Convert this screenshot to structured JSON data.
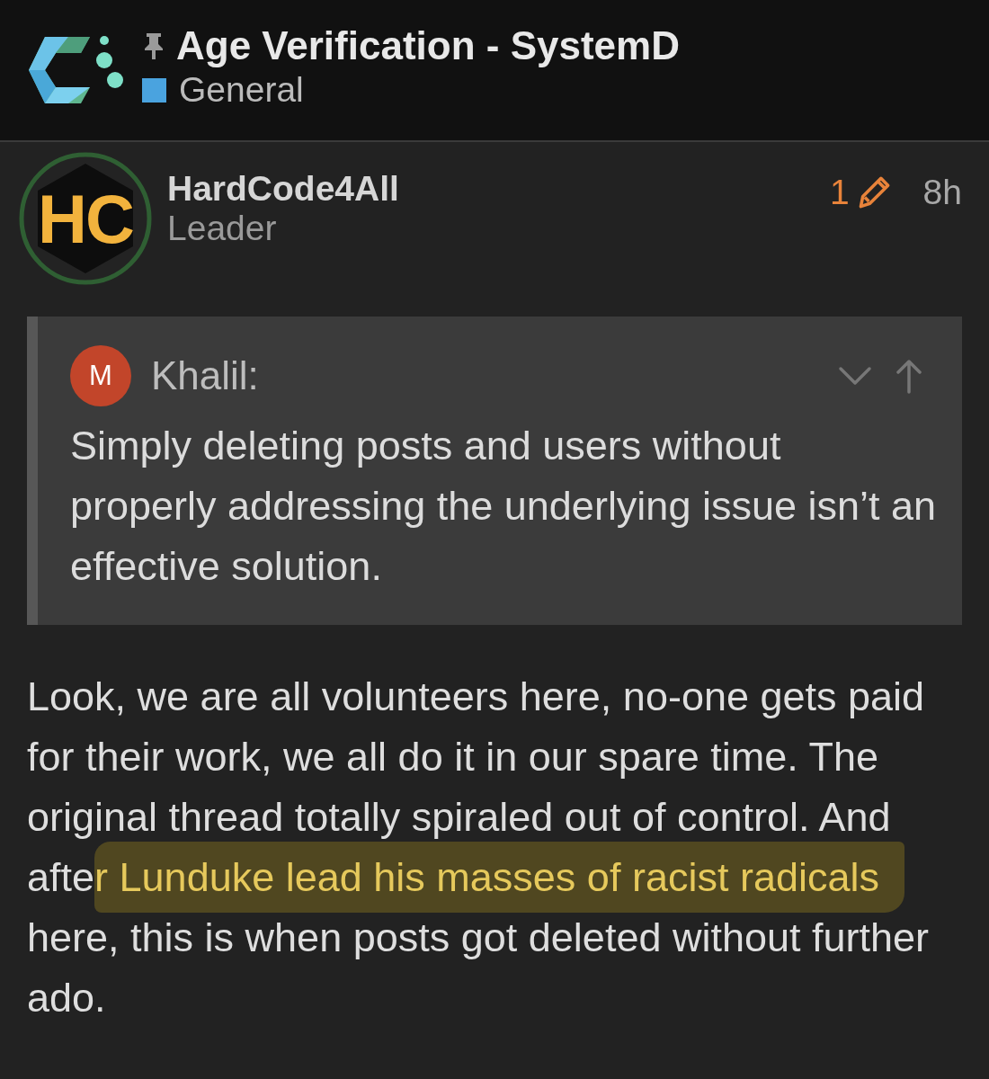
{
  "header": {
    "title": "Age Verification - SystemD",
    "pinned": true,
    "category": {
      "name": "General",
      "color": "#4aa3df"
    }
  },
  "post": {
    "author": {
      "avatar_text": "HC",
      "username": "HardCode4All",
      "title": "Leader"
    },
    "edit_count": "1",
    "age": "8h",
    "quote": {
      "avatar_initial": "M",
      "author": "Khalil:",
      "expanded": false,
      "text": "Simply deleting posts and users without properly addressing the underlying issue isn’t an effective solution."
    },
    "body": [
      {
        "text": "Look, we are all volunteers here, no-one gets paid for their work, we all do it in our spare time. The original thread totally spiraled out of control. And afte",
        "highlighted": false
      },
      {
        "text": "r Lunduke lead his masses of racist radicals",
        "highlighted": true
      },
      {
        "text": " here, this is when posts got deleted without further ado.",
        "highlighted": false
      }
    ]
  }
}
